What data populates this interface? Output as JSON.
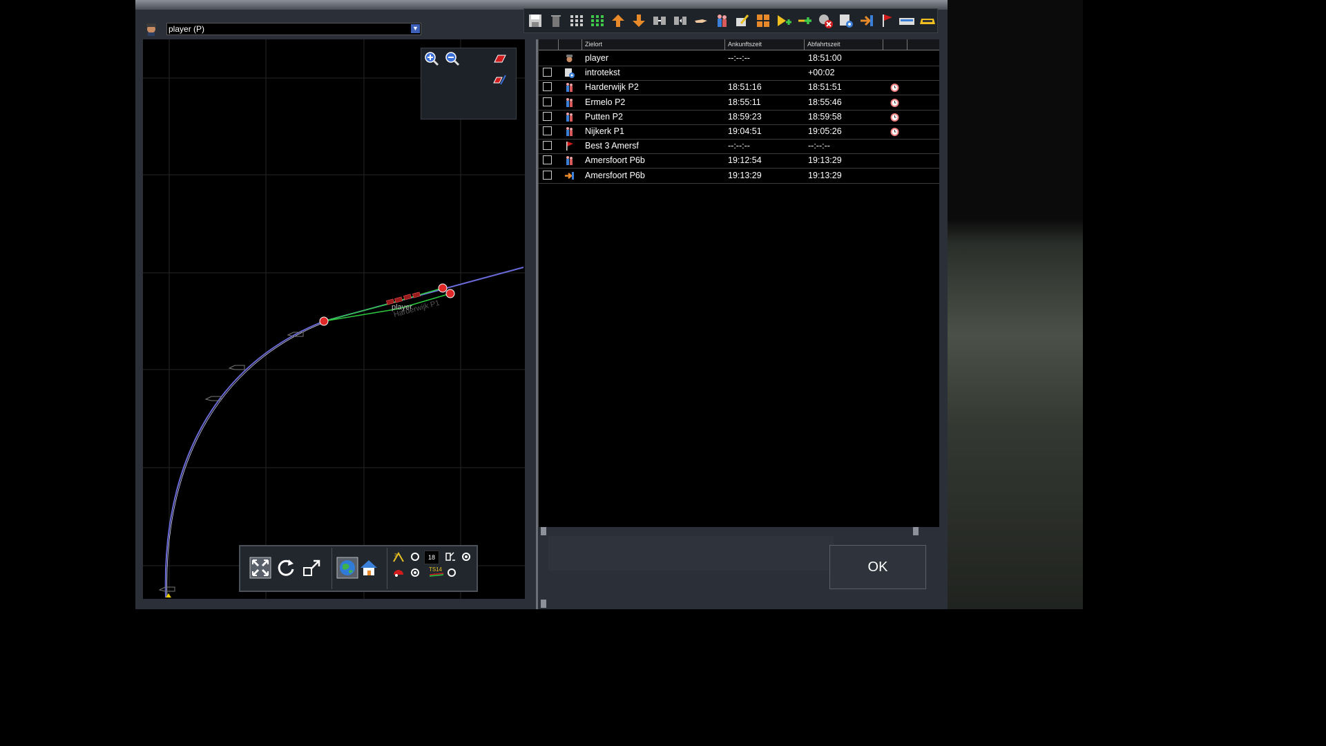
{
  "map": {
    "player_select": {
      "value": "player (P)"
    },
    "labels": {
      "player": "player",
      "station": "Harderwijk P1"
    },
    "toolbar": {
      "speed_value": "18",
      "ts_label": "TS14"
    }
  },
  "timetable": {
    "headers": {
      "destination": "Zielort",
      "arrival": "Ankunftszeit",
      "departure": "Abfahrtszeit"
    },
    "rows": [
      {
        "icon": "driver-icon",
        "checkbox": false,
        "destination": "player",
        "arrival": "--:--:--",
        "departure": "18:51:00",
        "alarm": false
      },
      {
        "icon": "settings-icon",
        "checkbox": true,
        "destination": "introtekst",
        "arrival": "",
        "departure": "+00:02",
        "alarm": false
      },
      {
        "icon": "passengers-icon",
        "checkbox": true,
        "destination": "Harderwijk P2",
        "arrival": "18:51:16",
        "departure": "18:51:51",
        "alarm": true
      },
      {
        "icon": "passengers-icon",
        "checkbox": true,
        "destination": "Ermelo P2",
        "arrival": "18:55:11",
        "departure": "18:55:46",
        "alarm": true
      },
      {
        "icon": "passengers-icon",
        "checkbox": true,
        "destination": "Putten P2",
        "arrival": "18:59:23",
        "departure": "18:59:58",
        "alarm": true
      },
      {
        "icon": "passengers-icon",
        "checkbox": true,
        "destination": "Nijkerk P1",
        "arrival": "19:04:51",
        "departure": "19:05:26",
        "alarm": true
      },
      {
        "icon": "flag-icon",
        "checkbox": true,
        "destination": "Best 3 Amersf",
        "arrival": "--:--:--",
        "departure": "--:--:--",
        "alarm": false
      },
      {
        "icon": "passengers-icon",
        "checkbox": true,
        "destination": "Amersfoort P6b",
        "arrival": "19:12:54",
        "departure": "19:13:29",
        "alarm": false
      },
      {
        "icon": "exit-arrow-icon",
        "checkbox": true,
        "destination": "Amersfoort P6b",
        "arrival": "19:13:29",
        "departure": "19:13:29",
        "alarm": false
      }
    ]
  },
  "ok_button": {
    "label": "OK"
  },
  "colors": {
    "accent_green": "#2ecc40",
    "track_blue": "#6a6ad8",
    "marker_red": "#e02828"
  }
}
